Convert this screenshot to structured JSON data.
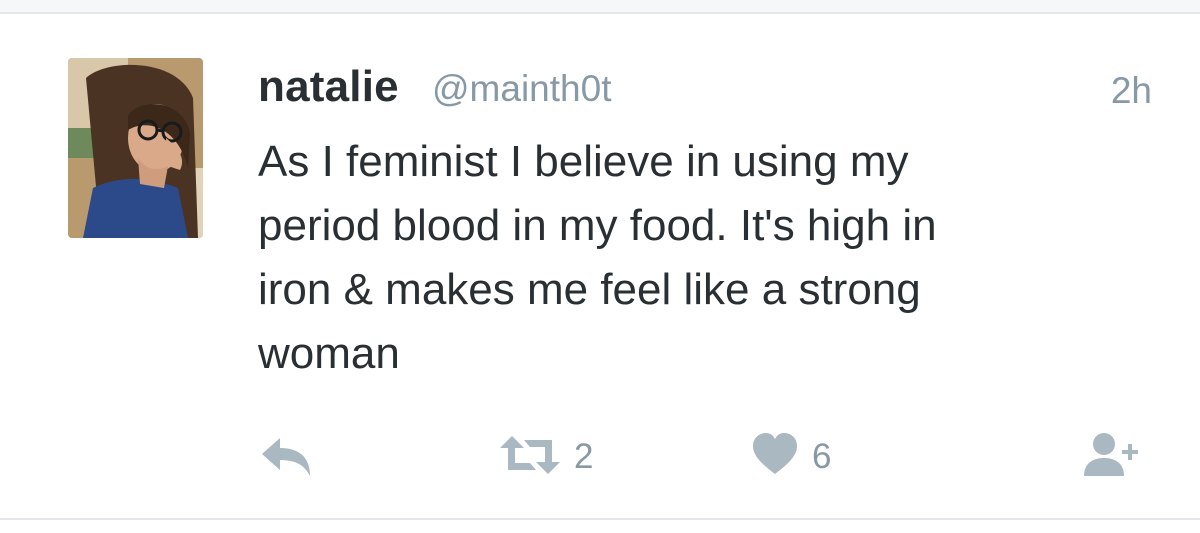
{
  "tweet": {
    "display_name": "natalie",
    "handle": "@mainth0t",
    "time": "2h",
    "text": "As I feminist I believe in using my\nperiod blood in my food. It's high in\niron & makes me feel like a strong\nwoman",
    "actions": {
      "reply_icon": "reply-arrow-icon",
      "retweet_icon": "retweet-icon",
      "retweet_count": "2",
      "like_icon": "heart-icon",
      "like_count": "6",
      "follow_icon": "add-user-icon"
    }
  },
  "colors": {
    "text_primary": "#292f33",
    "text_secondary": "#8899a6",
    "icon": "#aab8c2",
    "divider": "#e3e7eb"
  }
}
